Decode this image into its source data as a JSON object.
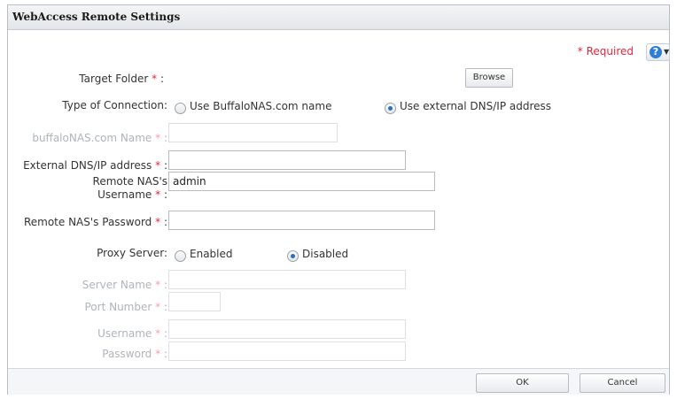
{
  "dialog": {
    "title": "WebAccess Remote Settings",
    "required_note": "* Required",
    "help_icon": "question-circle-icon"
  },
  "form": {
    "target_folder": {
      "label": "Target Folder",
      "browse_label": "Browse"
    },
    "connection_type": {
      "label": "Type of Connection:",
      "options": [
        "Use BuffaloNAS.com name",
        "Use external DNS/IP address"
      ],
      "selected": "Use external DNS/IP address"
    },
    "buffalonas_name": {
      "label": "buffaloNAS.com Name",
      "value": "",
      "disabled": true
    },
    "external_dns": {
      "label": "External DNS/IP address",
      "value": ""
    },
    "remote_username": {
      "label_line1": "Remote NAS's",
      "label_line2": "Username",
      "value": "admin"
    },
    "remote_password": {
      "label": "Remote NAS's Password",
      "value": ""
    },
    "proxy_server": {
      "label": "Proxy Server:",
      "options": [
        "Enabled",
        "Disabled"
      ],
      "selected": "Disabled"
    },
    "server_name": {
      "label": "Server Name",
      "value": "",
      "disabled": true
    },
    "port_number": {
      "label": "Port Number",
      "value": "",
      "disabled": true
    },
    "proxy_username": {
      "label": "Username",
      "value": "",
      "disabled": true
    },
    "proxy_password": {
      "label": "Password",
      "value": "",
      "disabled": true
    }
  },
  "footer": {
    "ok_label": "OK",
    "cancel_label": "Cancel"
  },
  "colors": {
    "required": "#e0283e",
    "accent": "#2d7fd6",
    "disabled_text": "#aeb4ba"
  }
}
